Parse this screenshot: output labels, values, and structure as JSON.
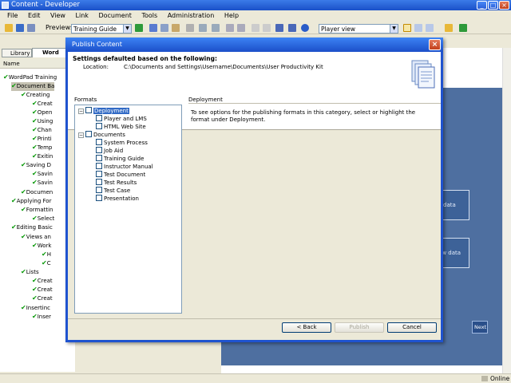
{
  "window": {
    "title": "Content - Developer",
    "controls": {
      "minimize": "_",
      "maximize": "□",
      "close": "×"
    }
  },
  "menubar": {
    "items": [
      "File",
      "Edit",
      "View",
      "Link",
      "Document",
      "Tools",
      "Administration",
      "Help"
    ]
  },
  "toolbar": {
    "preview_label": "Preview:",
    "preview_value": "Training Guide",
    "view_value": "Player view"
  },
  "left_pane": {
    "tabs": [
      {
        "label": "Library"
      },
      {
        "label": "Word"
      }
    ],
    "column_header": "Name",
    "tree": [
      {
        "label": "WordPad Training"
      },
      {
        "label": "Document Ba"
      },
      {
        "label": "Creating"
      },
      {
        "label": "Creat"
      },
      {
        "label": "Open"
      },
      {
        "label": "Using"
      },
      {
        "label": "Chan"
      },
      {
        "label": "Printi"
      },
      {
        "label": "Temp"
      },
      {
        "label": "Exitin"
      },
      {
        "label": "Saving D"
      },
      {
        "label": "Savin"
      },
      {
        "label": "Savin"
      },
      {
        "label": "Documen"
      },
      {
        "label": "Applying For"
      },
      {
        "label": "Formattin"
      },
      {
        "label": "Select"
      },
      {
        "label": "Editing Basic"
      },
      {
        "label": "Views an"
      },
      {
        "label": "Work"
      },
      {
        "label": "H"
      },
      {
        "label": "C"
      },
      {
        "label": "Lists"
      },
      {
        "label": "Creat"
      },
      {
        "label": "Creat"
      },
      {
        "label": "Creat"
      },
      {
        "label": "Insertinc"
      },
      {
        "label": "Inser"
      }
    ]
  },
  "preview": {
    "box1": "data",
    "box2": "ew data",
    "next": "Next"
  },
  "statusbar": {
    "status": "Online"
  },
  "dialog": {
    "title": "Publish Content",
    "header_title": "Settings defaulted based on the following:",
    "location_label": "Location:",
    "location_value": "C:\\Documents and Settings\\Username\\Documents\\User Productivity Kit",
    "formats_label": "Formats",
    "formats": {
      "deployment": {
        "label": "Deployment",
        "children": [
          "Player and LMS",
          "HTML Web Site"
        ]
      },
      "documents": {
        "label": "Documents",
        "children": [
          "System Process",
          "Job Aid",
          "Training Guide",
          "Instructor Manual",
          "Test Document",
          "Test Results",
          "Test Case",
          "Presentation"
        ]
      }
    },
    "detail_title": "Deployment",
    "detail_text": "To see options for the publishing formats in this category, select or highlight the format under Deployment.",
    "buttons": {
      "back": "< Back",
      "publish": "Publish",
      "cancel": "Cancel"
    }
  }
}
